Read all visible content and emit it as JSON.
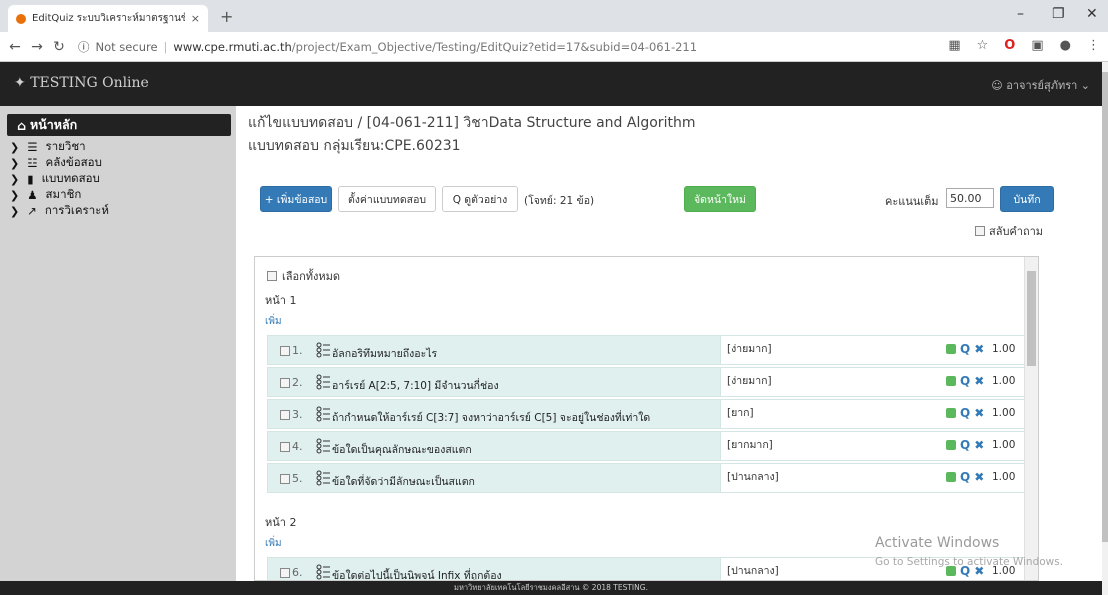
{
  "browser": {
    "tab_title": "EditQuiz ระบบวิเคราะห์มาตรฐานข้อส",
    "tab_close": "×",
    "new_tab": "+",
    "security": "Not secure",
    "url_host": "www.cpe.rmuti.ac.th",
    "url_path": "/project/Exam_Objective/Testing/EditQuiz?etid=17&subid=04-061-211"
  },
  "navbar": {
    "brand": "TESTING Online",
    "user": "อาจารย์สุภัทรา"
  },
  "sidebar": {
    "home": "หน้าหลัก",
    "items": [
      {
        "label": "รายวิชา",
        "icon": "list-icon"
      },
      {
        "label": "คลังข้อสอบ",
        "icon": "database-icon"
      },
      {
        "label": "แบบทดสอบ",
        "icon": "book-icon"
      },
      {
        "label": "สมาชิก",
        "icon": "users-icon"
      },
      {
        "label": "การวิเคราะห์",
        "icon": "chart-icon"
      }
    ]
  },
  "main": {
    "title": "แก้ไขแบบทดสอบ / [04-061-211] วิชาData Structure and Algorithm",
    "subtitle": "แบบทดสอบ กลุ่มเรียน:CPE.60231",
    "toolbar": {
      "add_question": "+ เพิ่มข้อสอบ",
      "settings": "ตั้งค่าแบบทดสอบ",
      "preview": "Q ดูตัวอย่าง",
      "count": "(โจทย์: 21 ข้อ)",
      "rearrange": "จัดหน้าใหม่",
      "score_label": "คะแนนเต็ม",
      "score_value": "50.00",
      "save": "บันทึก",
      "shuffle": "สลับคำถาม"
    },
    "select_all": "เลือกทั้งหมด",
    "add_link": "เพิ่ม",
    "pages": [
      {
        "label": "หน้า 1",
        "questions": [
          {
            "num": "1.",
            "text": "อัลกอริทึมหมายถึงอะไร",
            "difficulty": "[ง่ายมาก]",
            "score": "1.00"
          },
          {
            "num": "2.",
            "text": "อาร์เรย์ A[2:5, 7:10] มีจำนวนกี่ช่อง",
            "difficulty": "[ง่ายมาก]",
            "score": "1.00"
          },
          {
            "num": "3.",
            "text": "ถ้ากำหนดให้อาร์เรย์ C[3:7] จงหาว่าอาร์เรย์ C[5] จะอยู่ในช่องที่เท่าใด",
            "difficulty": "[ยาก]",
            "score": "1.00"
          },
          {
            "num": "4.",
            "text": "ข้อใดเป็นคุณลักษณะของสแตก",
            "difficulty": "[ยากมาก]",
            "score": "1.00"
          },
          {
            "num": "5.",
            "text": "ข้อใดที่จัดว่ามีลักษณะเป็นสแตก",
            "difficulty": "[ปานกลาง]",
            "score": "1.00"
          }
        ]
      },
      {
        "label": "หน้า 2",
        "questions": [
          {
            "num": "6.",
            "text": "ข้อใดต่อไปนี้เป็นนิพจน์ Infix ที่ถูกต้อง",
            "difficulty": "[ปานกลาง]",
            "score": "1.00"
          }
        ]
      }
    ]
  },
  "watermark": {
    "line1": "Activate Windows",
    "line2": "Go to Settings to activate Windows."
  },
  "footer": "มหาวิทยาลัยเทคโนโลยีราชมงคลอีสาน © 2018 TESTING."
}
